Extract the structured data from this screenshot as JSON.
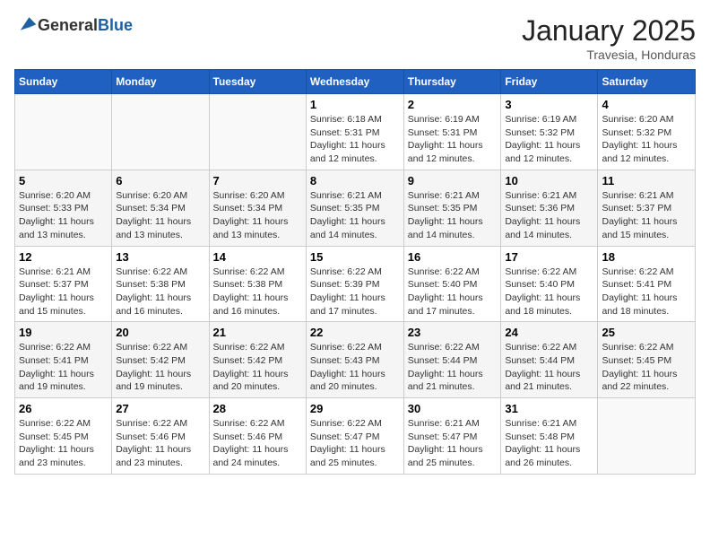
{
  "header": {
    "logo_general": "General",
    "logo_blue": "Blue",
    "month": "January 2025",
    "location": "Travesia, Honduras"
  },
  "weekdays": [
    "Sunday",
    "Monday",
    "Tuesday",
    "Wednesday",
    "Thursday",
    "Friday",
    "Saturday"
  ],
  "weeks": [
    [
      {
        "day": "",
        "sunrise": "",
        "sunset": "",
        "daylight": ""
      },
      {
        "day": "",
        "sunrise": "",
        "sunset": "",
        "daylight": ""
      },
      {
        "day": "",
        "sunrise": "",
        "sunset": "",
        "daylight": ""
      },
      {
        "day": "1",
        "sunrise": "Sunrise: 6:18 AM",
        "sunset": "Sunset: 5:31 PM",
        "daylight": "Daylight: 11 hours and 12 minutes."
      },
      {
        "day": "2",
        "sunrise": "Sunrise: 6:19 AM",
        "sunset": "Sunset: 5:31 PM",
        "daylight": "Daylight: 11 hours and 12 minutes."
      },
      {
        "day": "3",
        "sunrise": "Sunrise: 6:19 AM",
        "sunset": "Sunset: 5:32 PM",
        "daylight": "Daylight: 11 hours and 12 minutes."
      },
      {
        "day": "4",
        "sunrise": "Sunrise: 6:20 AM",
        "sunset": "Sunset: 5:32 PM",
        "daylight": "Daylight: 11 hours and 12 minutes."
      }
    ],
    [
      {
        "day": "5",
        "sunrise": "Sunrise: 6:20 AM",
        "sunset": "Sunset: 5:33 PM",
        "daylight": "Daylight: 11 hours and 13 minutes."
      },
      {
        "day": "6",
        "sunrise": "Sunrise: 6:20 AM",
        "sunset": "Sunset: 5:34 PM",
        "daylight": "Daylight: 11 hours and 13 minutes."
      },
      {
        "day": "7",
        "sunrise": "Sunrise: 6:20 AM",
        "sunset": "Sunset: 5:34 PM",
        "daylight": "Daylight: 11 hours and 13 minutes."
      },
      {
        "day": "8",
        "sunrise": "Sunrise: 6:21 AM",
        "sunset": "Sunset: 5:35 PM",
        "daylight": "Daylight: 11 hours and 14 minutes."
      },
      {
        "day": "9",
        "sunrise": "Sunrise: 6:21 AM",
        "sunset": "Sunset: 5:35 PM",
        "daylight": "Daylight: 11 hours and 14 minutes."
      },
      {
        "day": "10",
        "sunrise": "Sunrise: 6:21 AM",
        "sunset": "Sunset: 5:36 PM",
        "daylight": "Daylight: 11 hours and 14 minutes."
      },
      {
        "day": "11",
        "sunrise": "Sunrise: 6:21 AM",
        "sunset": "Sunset: 5:37 PM",
        "daylight": "Daylight: 11 hours and 15 minutes."
      }
    ],
    [
      {
        "day": "12",
        "sunrise": "Sunrise: 6:21 AM",
        "sunset": "Sunset: 5:37 PM",
        "daylight": "Daylight: 11 hours and 15 minutes."
      },
      {
        "day": "13",
        "sunrise": "Sunrise: 6:22 AM",
        "sunset": "Sunset: 5:38 PM",
        "daylight": "Daylight: 11 hours and 16 minutes."
      },
      {
        "day": "14",
        "sunrise": "Sunrise: 6:22 AM",
        "sunset": "Sunset: 5:38 PM",
        "daylight": "Daylight: 11 hours and 16 minutes."
      },
      {
        "day": "15",
        "sunrise": "Sunrise: 6:22 AM",
        "sunset": "Sunset: 5:39 PM",
        "daylight": "Daylight: 11 hours and 17 minutes."
      },
      {
        "day": "16",
        "sunrise": "Sunrise: 6:22 AM",
        "sunset": "Sunset: 5:40 PM",
        "daylight": "Daylight: 11 hours and 17 minutes."
      },
      {
        "day": "17",
        "sunrise": "Sunrise: 6:22 AM",
        "sunset": "Sunset: 5:40 PM",
        "daylight": "Daylight: 11 hours and 18 minutes."
      },
      {
        "day": "18",
        "sunrise": "Sunrise: 6:22 AM",
        "sunset": "Sunset: 5:41 PM",
        "daylight": "Daylight: 11 hours and 18 minutes."
      }
    ],
    [
      {
        "day": "19",
        "sunrise": "Sunrise: 6:22 AM",
        "sunset": "Sunset: 5:41 PM",
        "daylight": "Daylight: 11 hours and 19 minutes."
      },
      {
        "day": "20",
        "sunrise": "Sunrise: 6:22 AM",
        "sunset": "Sunset: 5:42 PM",
        "daylight": "Daylight: 11 hours and 19 minutes."
      },
      {
        "day": "21",
        "sunrise": "Sunrise: 6:22 AM",
        "sunset": "Sunset: 5:42 PM",
        "daylight": "Daylight: 11 hours and 20 minutes."
      },
      {
        "day": "22",
        "sunrise": "Sunrise: 6:22 AM",
        "sunset": "Sunset: 5:43 PM",
        "daylight": "Daylight: 11 hours and 20 minutes."
      },
      {
        "day": "23",
        "sunrise": "Sunrise: 6:22 AM",
        "sunset": "Sunset: 5:44 PM",
        "daylight": "Daylight: 11 hours and 21 minutes."
      },
      {
        "day": "24",
        "sunrise": "Sunrise: 6:22 AM",
        "sunset": "Sunset: 5:44 PM",
        "daylight": "Daylight: 11 hours and 21 minutes."
      },
      {
        "day": "25",
        "sunrise": "Sunrise: 6:22 AM",
        "sunset": "Sunset: 5:45 PM",
        "daylight": "Daylight: 11 hours and 22 minutes."
      }
    ],
    [
      {
        "day": "26",
        "sunrise": "Sunrise: 6:22 AM",
        "sunset": "Sunset: 5:45 PM",
        "daylight": "Daylight: 11 hours and 23 minutes."
      },
      {
        "day": "27",
        "sunrise": "Sunrise: 6:22 AM",
        "sunset": "Sunset: 5:46 PM",
        "daylight": "Daylight: 11 hours and 23 minutes."
      },
      {
        "day": "28",
        "sunrise": "Sunrise: 6:22 AM",
        "sunset": "Sunset: 5:46 PM",
        "daylight": "Daylight: 11 hours and 24 minutes."
      },
      {
        "day": "29",
        "sunrise": "Sunrise: 6:22 AM",
        "sunset": "Sunset: 5:47 PM",
        "daylight": "Daylight: 11 hours and 25 minutes."
      },
      {
        "day": "30",
        "sunrise": "Sunrise: 6:21 AM",
        "sunset": "Sunset: 5:47 PM",
        "daylight": "Daylight: 11 hours and 25 minutes."
      },
      {
        "day": "31",
        "sunrise": "Sunrise: 6:21 AM",
        "sunset": "Sunset: 5:48 PM",
        "daylight": "Daylight: 11 hours and 26 minutes."
      },
      {
        "day": "",
        "sunrise": "",
        "sunset": "",
        "daylight": ""
      }
    ]
  ]
}
